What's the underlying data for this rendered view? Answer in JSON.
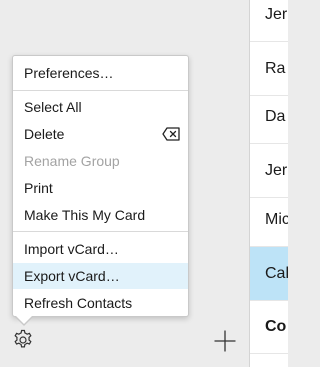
{
  "menu": {
    "items": [
      {
        "label": "Preferences…",
        "disabled": false
      },
      {
        "label": "Select All",
        "disabled": false
      },
      {
        "label": "Delete",
        "disabled": false
      },
      {
        "label": "Rename Group",
        "disabled": true
      },
      {
        "label": "Print",
        "disabled": false
      },
      {
        "label": "Make This My Card",
        "disabled": false
      },
      {
        "label": "Import vCard…",
        "disabled": false
      },
      {
        "label": "Export vCard…",
        "disabled": false,
        "highlighted": true
      },
      {
        "label": "Refresh Contacts",
        "disabled": false
      }
    ],
    "delete_key_icon": "delete-backward-icon"
  },
  "contacts": [
    {
      "name": "Jer"
    },
    {
      "name": "Ra"
    },
    {
      "name": "Da"
    },
    {
      "name": "Jer"
    },
    {
      "name": "Mic"
    },
    {
      "name": "Cal",
      "selected": true
    },
    {
      "name": "Co",
      "bold": true
    }
  ],
  "toolbar": {
    "settings_icon": "gear-icon",
    "add_icon": "plus-icon"
  },
  "colors": {
    "selection": "#bde3f7",
    "menu_highlight": "#e1f2fb",
    "disabled_text": "#a3a3a3"
  }
}
